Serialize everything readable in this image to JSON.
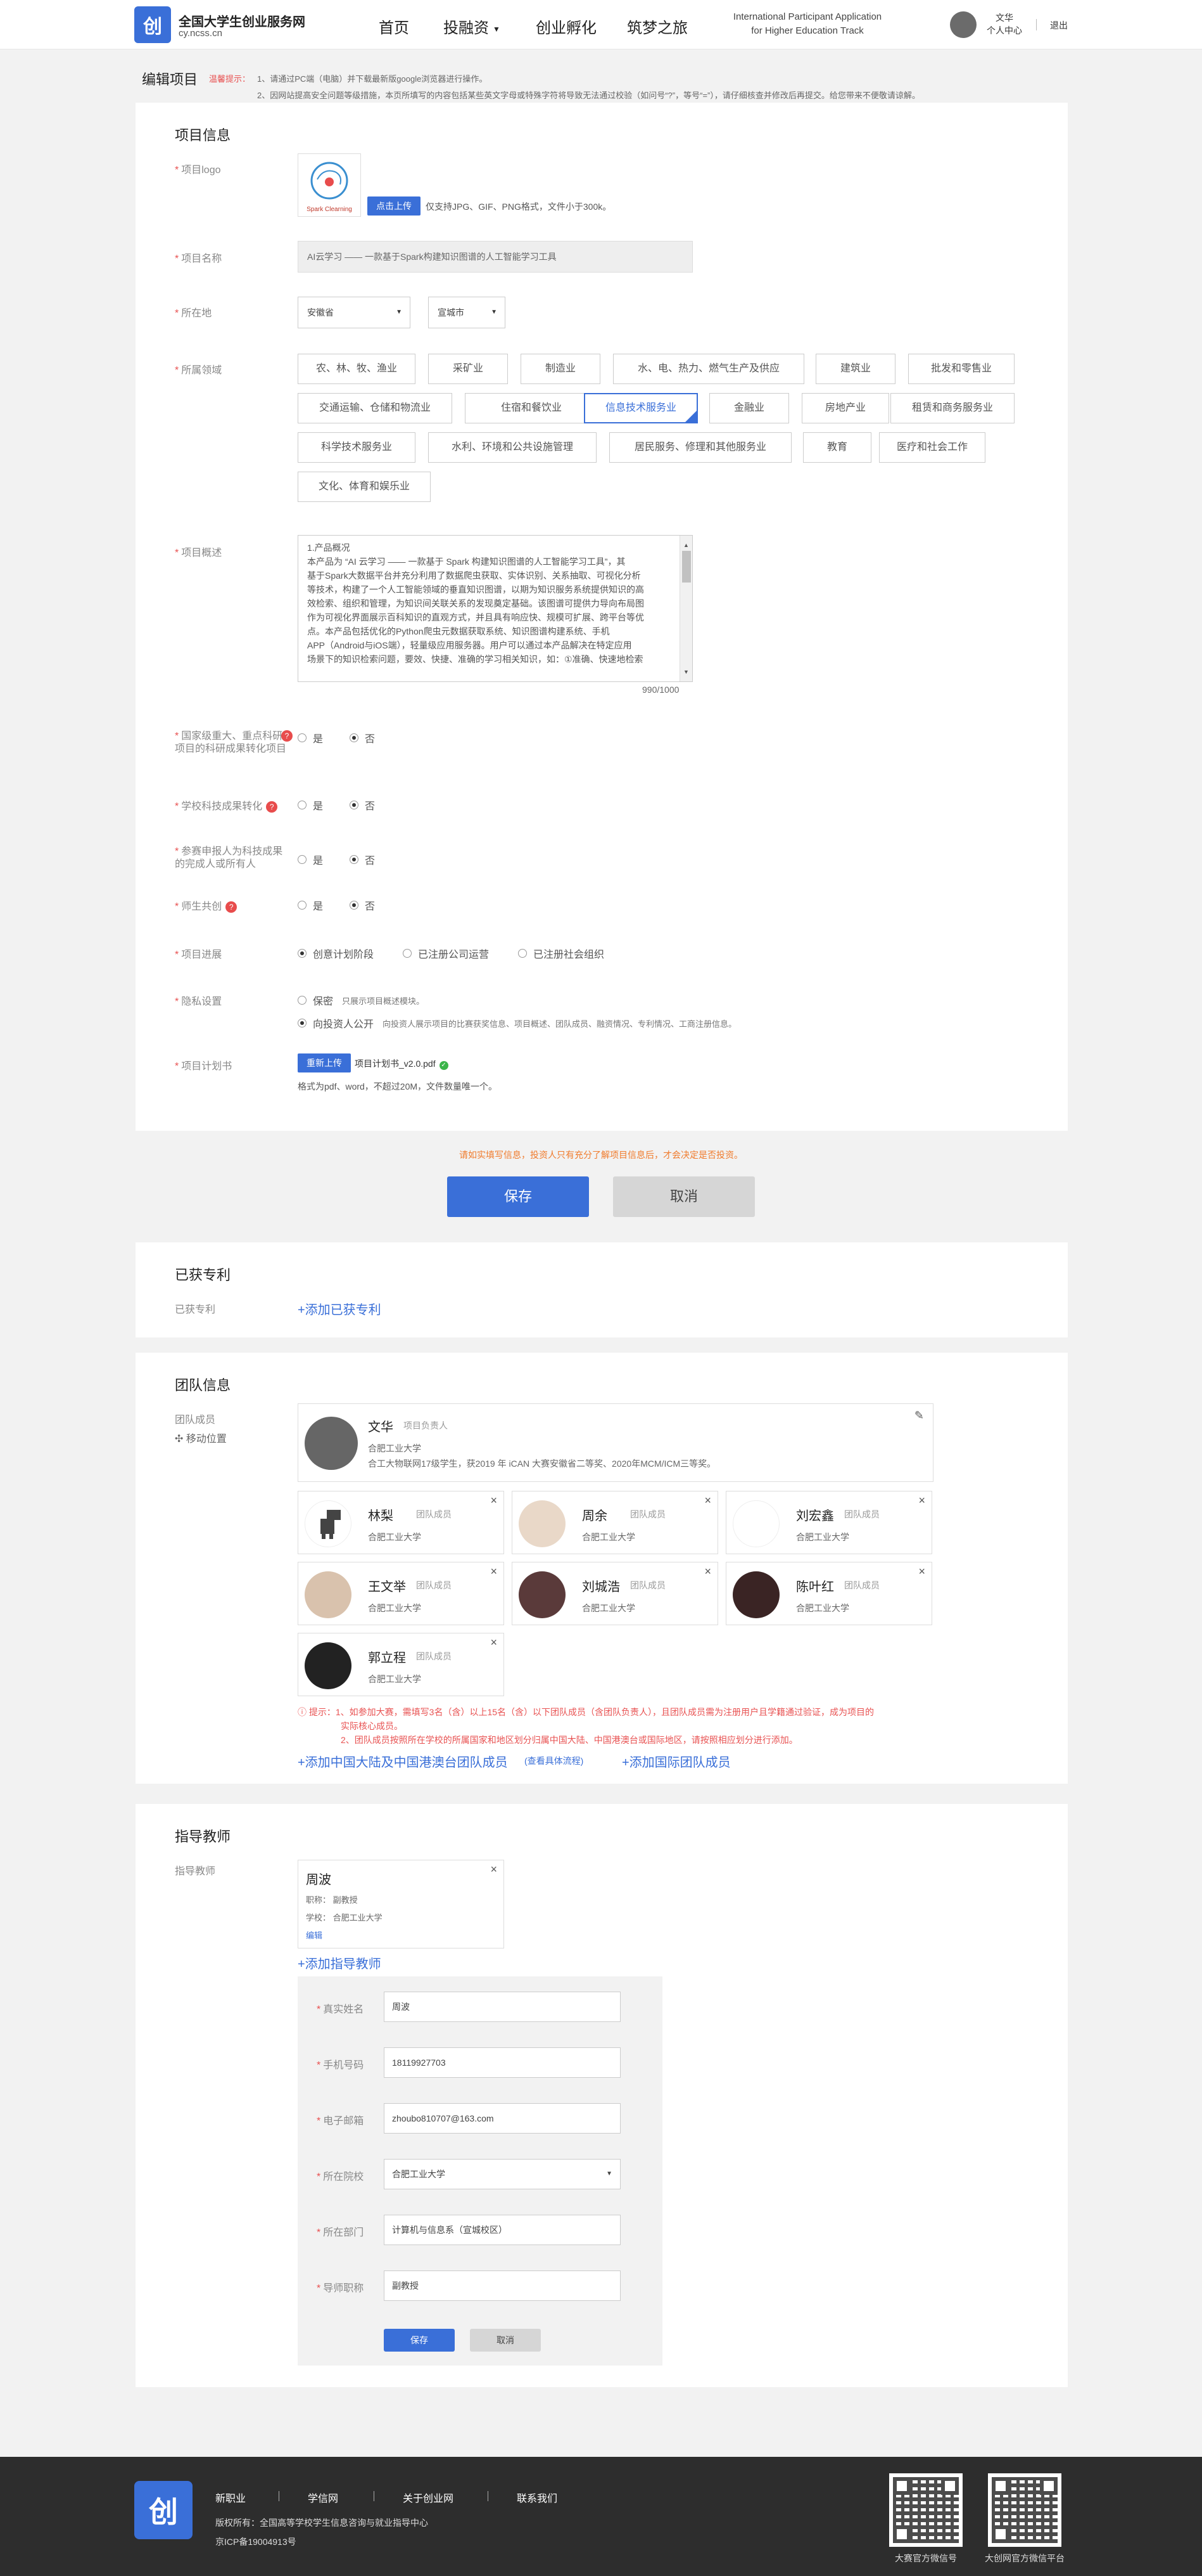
{
  "header": {
    "logo_mark": "创",
    "site_title": "全国大学生创业服务网",
    "site_domain": "cy.ncss.cn",
    "nav": [
      "首页",
      "投融资",
      "创业孵化",
      "筑梦之旅"
    ],
    "nav_en_line1": "International Participant Application",
    "nav_en_line2": "for Higher Education Track",
    "user_name": "文华",
    "user_center": "个人中心",
    "logout": "退出"
  },
  "page": {
    "title": "编辑项目",
    "tip_label": "温馨提示：",
    "tip1": "1、请通过PC端（电脑）并下载最新版google浏览器进行操作。",
    "tip2": "2、因网站提高安全问题等级措施，本页所填写的内容包括某些英文字母或特殊字符将导致无法通过校验（如问号“?”，等号“=”），请仔细核查并修改后再提交。给您带来不便敬请谅解。"
  },
  "project": {
    "section_title": "项目信息",
    "logo_label": "项目logo",
    "logo_brand": "Spark Clearning",
    "upload_btn": "点击上传",
    "upload_hint": "仅支持JPG、GIF、PNG格式，文件小于300k。",
    "name_label": "项目名称",
    "name_value": "AI云学习 —— 一款基于Spark构建知识图谱的人工智能学习工具",
    "location_label": "所在地",
    "province": "安徽省",
    "city": "宣城市",
    "field_label": "所属领域",
    "fields": [
      "农、林、牧、渔业",
      "采矿业",
      "制造业",
      "水、电、热力、燃气生产及供应",
      "建筑业",
      "批发和零售业",
      "交通运输、仓储和物流业",
      "住宿和餐饮业",
      "信息技术服务业",
      "金融业",
      "房地产业",
      "租赁和商务服务业",
      "科学技术服务业",
      "水利、环境和公共设施管理",
      "居民服务、修理和其他服务业",
      "教育",
      "医疗和社会工作",
      "文化、体育和娱乐业"
    ],
    "desc_label": "项目概述",
    "desc_lines": [
      "1.产品概况",
      "本产品为 “AI 云学习 —— 一款基于 Spark 构建知识图谱的人工智能学习工具”，其",
      "基于Spark大数据平台并充分利用了数据爬虫获取、实体识别、关系抽取、可视化分析",
      "等技术，构建了一个人工智能领域的垂直知识图谱，以期为知识服务系统提供知识的高",
      "效检索、组织和管理，为知识间关联关系的发现奠定基础。该图谱可提供力导向布局图",
      "作为可视化界面展示百科知识的直观方式，并且具有响应快、规模可扩展、跨平台等优",
      "点。本产品包括优化的Python爬虫元数据获取系统、知识图谱构建系统、手机",
      "APP（Android与iOS端），轻量级应用服务器。用户可以通过本产品解决在特定应用",
      "场景下的知识检索问题，要效、快捷、准确的学习相关知识，如：①准确、快速地检索"
    ],
    "desc_counter": "990/1000",
    "q1_label": "国家级重大、重点科研项目的科研成果转化项目",
    "q2_label": "学校科技成果转化",
    "q3_label": "参赛申报人为科技成果的完成人或所有人",
    "q4_label": "师生共创",
    "yes": "是",
    "no": "否",
    "progress_label": "项目进展",
    "progress_opts": [
      "创意计划阶段",
      "已注册公司运营",
      "已注册社会组织"
    ],
    "privacy_label": "隐私设置",
    "privacy_opt1": "保密",
    "privacy_opt1_desc": "只展示项目概述模块。",
    "privacy_opt2": "向投资人公开",
    "privacy_opt2_desc": "向投资人展示项目的比赛获奖信息、项目概述、团队成员、融资情况、专利情况、工商注册信息。",
    "plan_label": "项目计划书",
    "reupload_btn": "重新上传",
    "plan_file": "项目计划书_v2.0.pdf",
    "plan_hint": "格式为pdf、word，不超过20M，文件数量唯一个。"
  },
  "actions": {
    "warn": "请如实填写信息，投资人只有充分了解项目信息后，才会决定是否投资。",
    "save": "保存",
    "cancel": "取消"
  },
  "patent": {
    "section_title": "已获专利",
    "label": "已获专利",
    "add": "+添加已获专利"
  },
  "team": {
    "section_title": "团队信息",
    "label": "团队成员",
    "move": "移动位置",
    "leader": {
      "name": "文华",
      "role": "项目负责人",
      "school": "合肥工业大学",
      "bio": "合工大物联网17级学生，获2019 年 iCAN 大赛安徽省二等奖、2020年MCM/ICM三等奖。"
    },
    "members": [
      {
        "name": "林梨",
        "role": "团队成员",
        "school": "合肥工业大学"
      },
      {
        "name": "周余",
        "role": "团队成员",
        "school": "合肥工业大学"
      },
      {
        "name": "刘宏鑫",
        "role": "团队成员",
        "school": "合肥工业大学"
      },
      {
        "name": "王文举",
        "role": "团队成员",
        "school": "合肥工业大学"
      },
      {
        "name": "刘城浩",
        "role": "团队成员",
        "school": "合肥工业大学"
      },
      {
        "name": "陈叶红",
        "role": "团队成员",
        "school": "合肥工业大学"
      },
      {
        "name": "郭立程",
        "role": "团队成员",
        "school": "合肥工业大学"
      }
    ],
    "warn1": "提示：1、如参加大赛，需填写3名（含）以上15名（含）以下团队成员（含团队负责人），且团队成员需为注册用户且学籍通过验证，成为项目的",
    "warn1b": "实际核心成员。",
    "warn2": "2、团队成员按照所在学校的所属国家和地区划分归属中国大陆、中国港澳台或国际地区，请按照相应划分进行添加。",
    "add_domestic": "+添加中国大陆及中国港澳台团队成员",
    "flow_link": "(查看具体流程)",
    "add_intl": "+添加国际团队成员"
  },
  "teacher": {
    "section_title": "指导教师",
    "label": "指导教师",
    "card_name": "周波",
    "card_title": "职称：  副教授",
    "card_school": "学校：  合肥工业大学",
    "card_edit": "编辑",
    "add": "+添加指导教师",
    "form": {
      "name_label": "真实姓名",
      "name": "周波",
      "phone_label": "手机号码",
      "phone": "18119927703",
      "email_label": "电子邮箱",
      "email": "zhoubo810707@163.com",
      "college_label": "所在院校",
      "college": "合肥工业大学",
      "dept_label": "所在部门",
      "dept": "计算机与信息系（宣城校区）",
      "title_label": "导师职称",
      "title": "副教授",
      "save": "保存",
      "cancel": "取消"
    }
  },
  "footer": {
    "logo_mark": "创",
    "links": [
      "新职业",
      "学信网",
      "关于创业网",
      "联系我们"
    ],
    "copyright": "版权所有：全国高等学校学生信息咨询与就业指导中心",
    "icp": "京ICP备19004913号",
    "qr1_label": "大赛官方微信号",
    "qr2_label": "大创网官方微信平台"
  },
  "colors": {
    "accent": "#3a6fd8",
    "warn": "#e85252",
    "orange": "#f07b2c"
  }
}
